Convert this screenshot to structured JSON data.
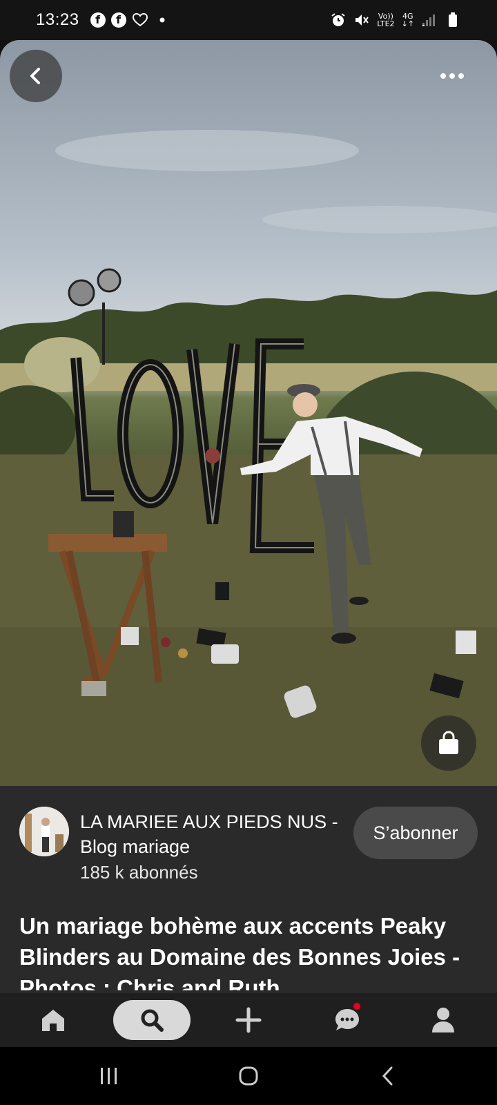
{
  "status_bar": {
    "time": "13:23",
    "left_icons": [
      "facebook-icon",
      "facebook-icon",
      "heart-icon",
      "dot-icon"
    ],
    "network_top": "Vo))",
    "network_bottom": "LTE2",
    "network_type": "4G",
    "right_icons": [
      "alarm-icon",
      "mute-icon",
      "signal-icon",
      "battery-icon"
    ]
  },
  "pin": {
    "image_alt": "Jeu de chamboule-tout devant des lettres LOVE",
    "sign_text": "LOVE",
    "actions": {
      "back_icon": "chevron-left-icon",
      "more_icon": "more-icon",
      "shop_icon": "shopping-bag-icon"
    }
  },
  "creator": {
    "name": "LA MARIEE AUX PIEDS NUS - Blog mariage",
    "followers": "185 k abonnés",
    "subscribe_label": "S’abonner"
  },
  "title": "Un mariage bohème aux accents Peaky Blinders au Domaine des Bonnes Joies - Photos : Chris and Ruth",
  "bottom_nav": {
    "items": [
      "home-icon",
      "search-icon",
      "plus-icon",
      "messages-icon",
      "profile-icon"
    ],
    "active": "search-icon",
    "has_notification": true
  },
  "system_nav": [
    "recents-icon",
    "home-circle-icon",
    "back-icon"
  ],
  "colors": {
    "accent_red": "#e60023",
    "panel_bg": "#2a2a2a",
    "nav_bg": "#1f1f1f"
  }
}
